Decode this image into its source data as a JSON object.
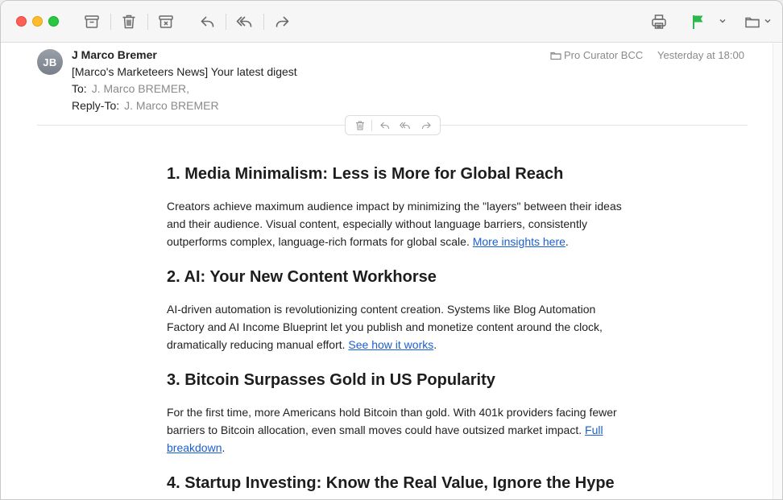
{
  "toolbar": {
    "buttons": [
      "archive-icon",
      "trash-icon",
      "junk-icon",
      "reply-icon",
      "reply-all-icon",
      "forward-icon",
      "print-icon",
      "flag-icon",
      "move-to-folder-icon"
    ],
    "flag_color": "#2db84d"
  },
  "message": {
    "avatar_initials": "JB",
    "sender": "J Marco Bremer",
    "subject": "[Marco's Marketeers News] Your latest digest",
    "to_label": "To:",
    "to_value": "J. Marco BREMER,",
    "reply_to_label": "Reply-To:",
    "reply_to_value": "J. Marco BREMER",
    "mailbox": "Pro Curator BCC",
    "date": "Yesterday at 18:00"
  },
  "body": {
    "sections": [
      {
        "heading": "1. Media Minimalism: Less is More for Global Reach",
        "text": "Creators achieve maximum audience impact by minimizing the \"layers\" between their ideas and their audience. Visual content, especially without language barriers, consistently outperforms complex, language-rich formats for global scale. ",
        "link": "More insights here",
        "after": "."
      },
      {
        "heading": "2. AI: Your New Content Workhorse",
        "text": "AI-driven automation is revolutionizing content creation. Systems like Blog Automation Factory and AI Income Blueprint let you publish and monetize content around the clock, dramatically reducing manual effort. ",
        "link": "See how it works",
        "after": "."
      },
      {
        "heading": "3. Bitcoin Surpasses Gold in US Popularity",
        "text": "For the first time, more Americans hold Bitcoin than gold. With 401k providers facing fewer barriers to Bitcoin allocation, even small moves could have outsized market impact. ",
        "link": "Full breakdown",
        "after": "."
      },
      {
        "heading": "4. Startup Investing: Know the Real Value, Ignore the Hype"
      }
    ]
  }
}
